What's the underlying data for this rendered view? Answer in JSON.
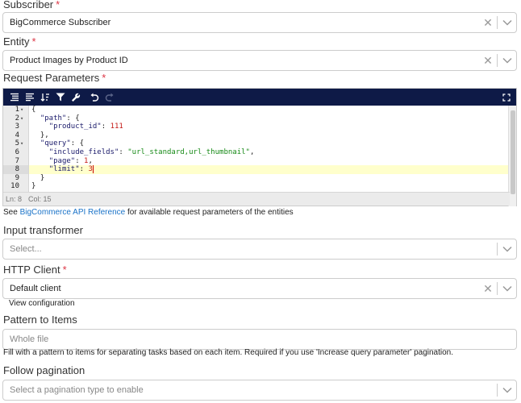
{
  "subscriber": {
    "label": "Subscriber",
    "required": "*",
    "value": "BigCommerce Subscriber",
    "clear": "✕"
  },
  "entity": {
    "label": "Entity",
    "required": "*",
    "value": "Product Images by Product ID",
    "clear": "✕"
  },
  "request_parameters": {
    "label": "Request Parameters",
    "required": "*",
    "line_numbers": [
      "1",
      "2",
      "3",
      "4",
      "5",
      "6",
      "7",
      "8",
      "9",
      "10"
    ],
    "status": {
      "ln": "Ln: 8",
      "col": "Col: 15"
    },
    "help_prefix": "See ",
    "help_link": "BigCommerce API Reference",
    "help_suffix": " for available request parameters of the entities"
  },
  "input_transformer": {
    "label": "Input transformer",
    "placeholder": "Select..."
  },
  "http_client": {
    "label": "HTTP Client",
    "required": "*",
    "value": "Default client",
    "clear": "✕",
    "view_config": "View configuration"
  },
  "pattern_to_items": {
    "label": "Pattern to Items",
    "placeholder": "Whole file",
    "help": "Fill with a pattern to items for separating tasks based on each item. Required if you use 'Increase query parameter' pagination."
  },
  "follow_pagination": {
    "label": "Follow pagination",
    "placeholder": "Select a pagination type to enable"
  },
  "colors": {
    "toolbar_bg": "#0e1a47",
    "required": "#dc3545",
    "link": "#1a73c8",
    "active_line": "#ffffcc"
  }
}
